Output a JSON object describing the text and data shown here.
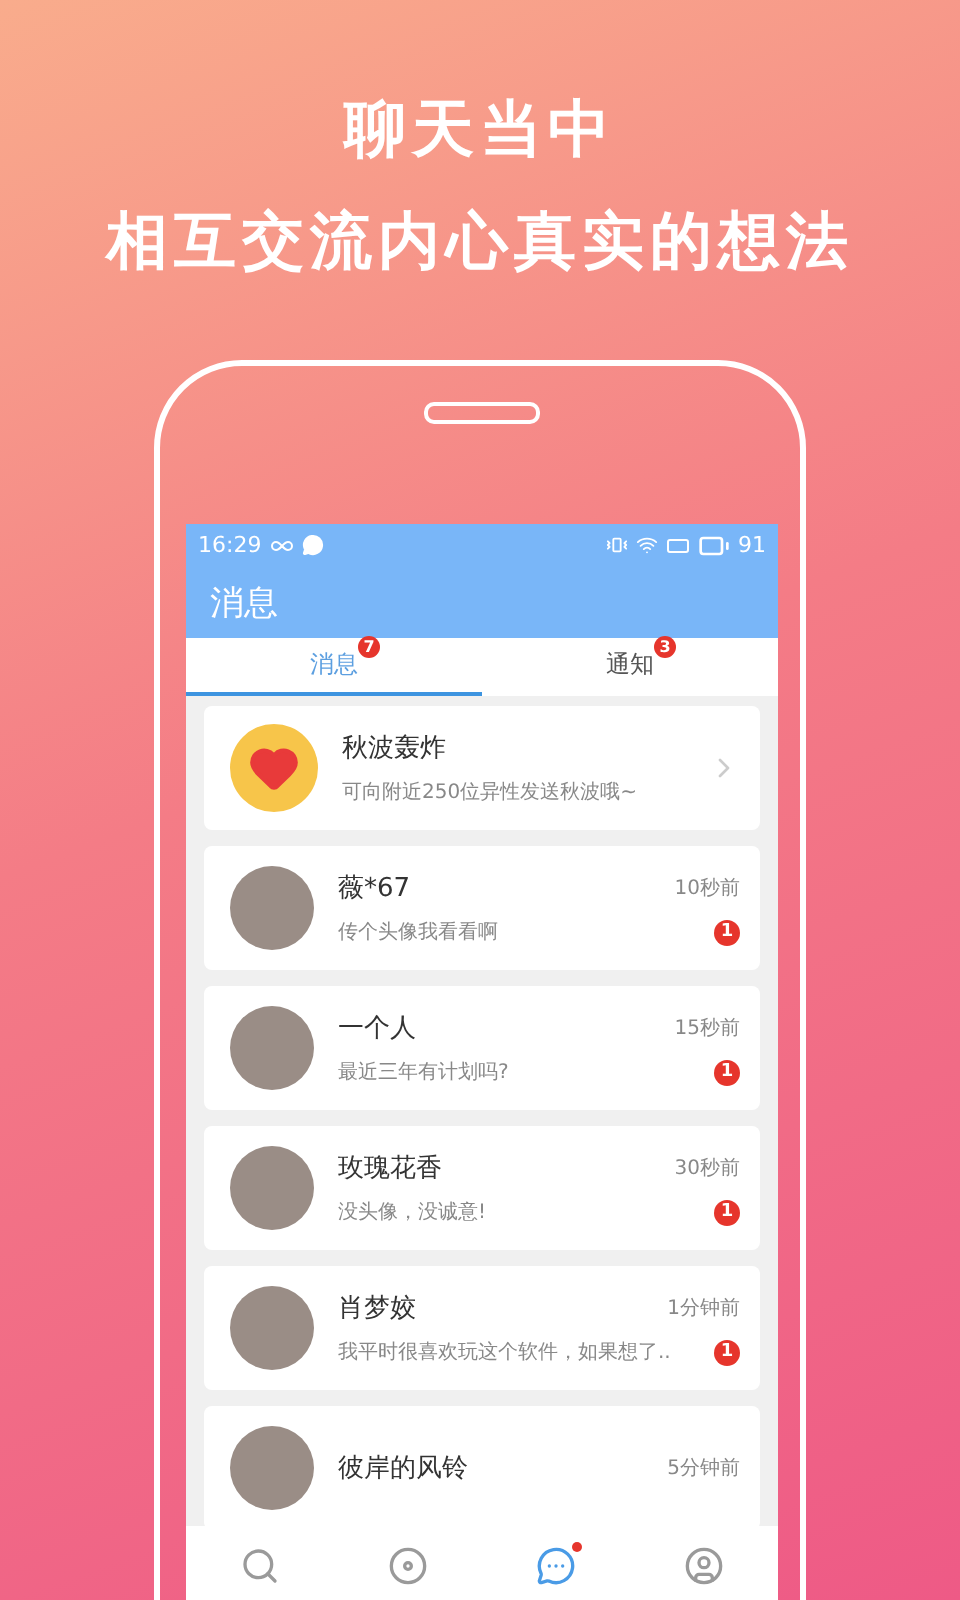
{
  "headline": [
    "聊天当中",
    "相互交流内心真实的想法"
  ],
  "status_bar": {
    "time": "16:29",
    "battery": "91"
  },
  "title": "消息",
  "tabs": [
    {
      "label": "消息",
      "badge": "7",
      "selected": true
    },
    {
      "label": "通知",
      "badge": "3",
      "selected": false
    }
  ],
  "promo": {
    "title": "秋波轰炸",
    "subtitle": "可向附近250位异性发送秋波哦~"
  },
  "chats": [
    {
      "name": "薇*67",
      "time": "10秒前",
      "preview": "传个头像我看看啊",
      "unread": "1"
    },
    {
      "name": "一个人",
      "time": "15秒前",
      "preview": "最近三年有计划吗?",
      "unread": "1"
    },
    {
      "name": "玫瑰花香",
      "time": "30秒前",
      "preview": "没头像，没诚意!",
      "unread": "1"
    },
    {
      "name": "肖梦姣",
      "time": "1分钟前",
      "preview": "我平时很喜欢玩这个软件，如果想了..",
      "unread": "1"
    },
    {
      "name": "彼岸的风铃",
      "time": "5分钟前"
    }
  ],
  "nav": [
    {
      "kind": "search",
      "selected": false,
      "dot": false
    },
    {
      "kind": "discover",
      "selected": false,
      "dot": false
    },
    {
      "kind": "chat",
      "selected": true,
      "dot": true
    },
    {
      "kind": "profile",
      "selected": false,
      "dot": false
    }
  ]
}
